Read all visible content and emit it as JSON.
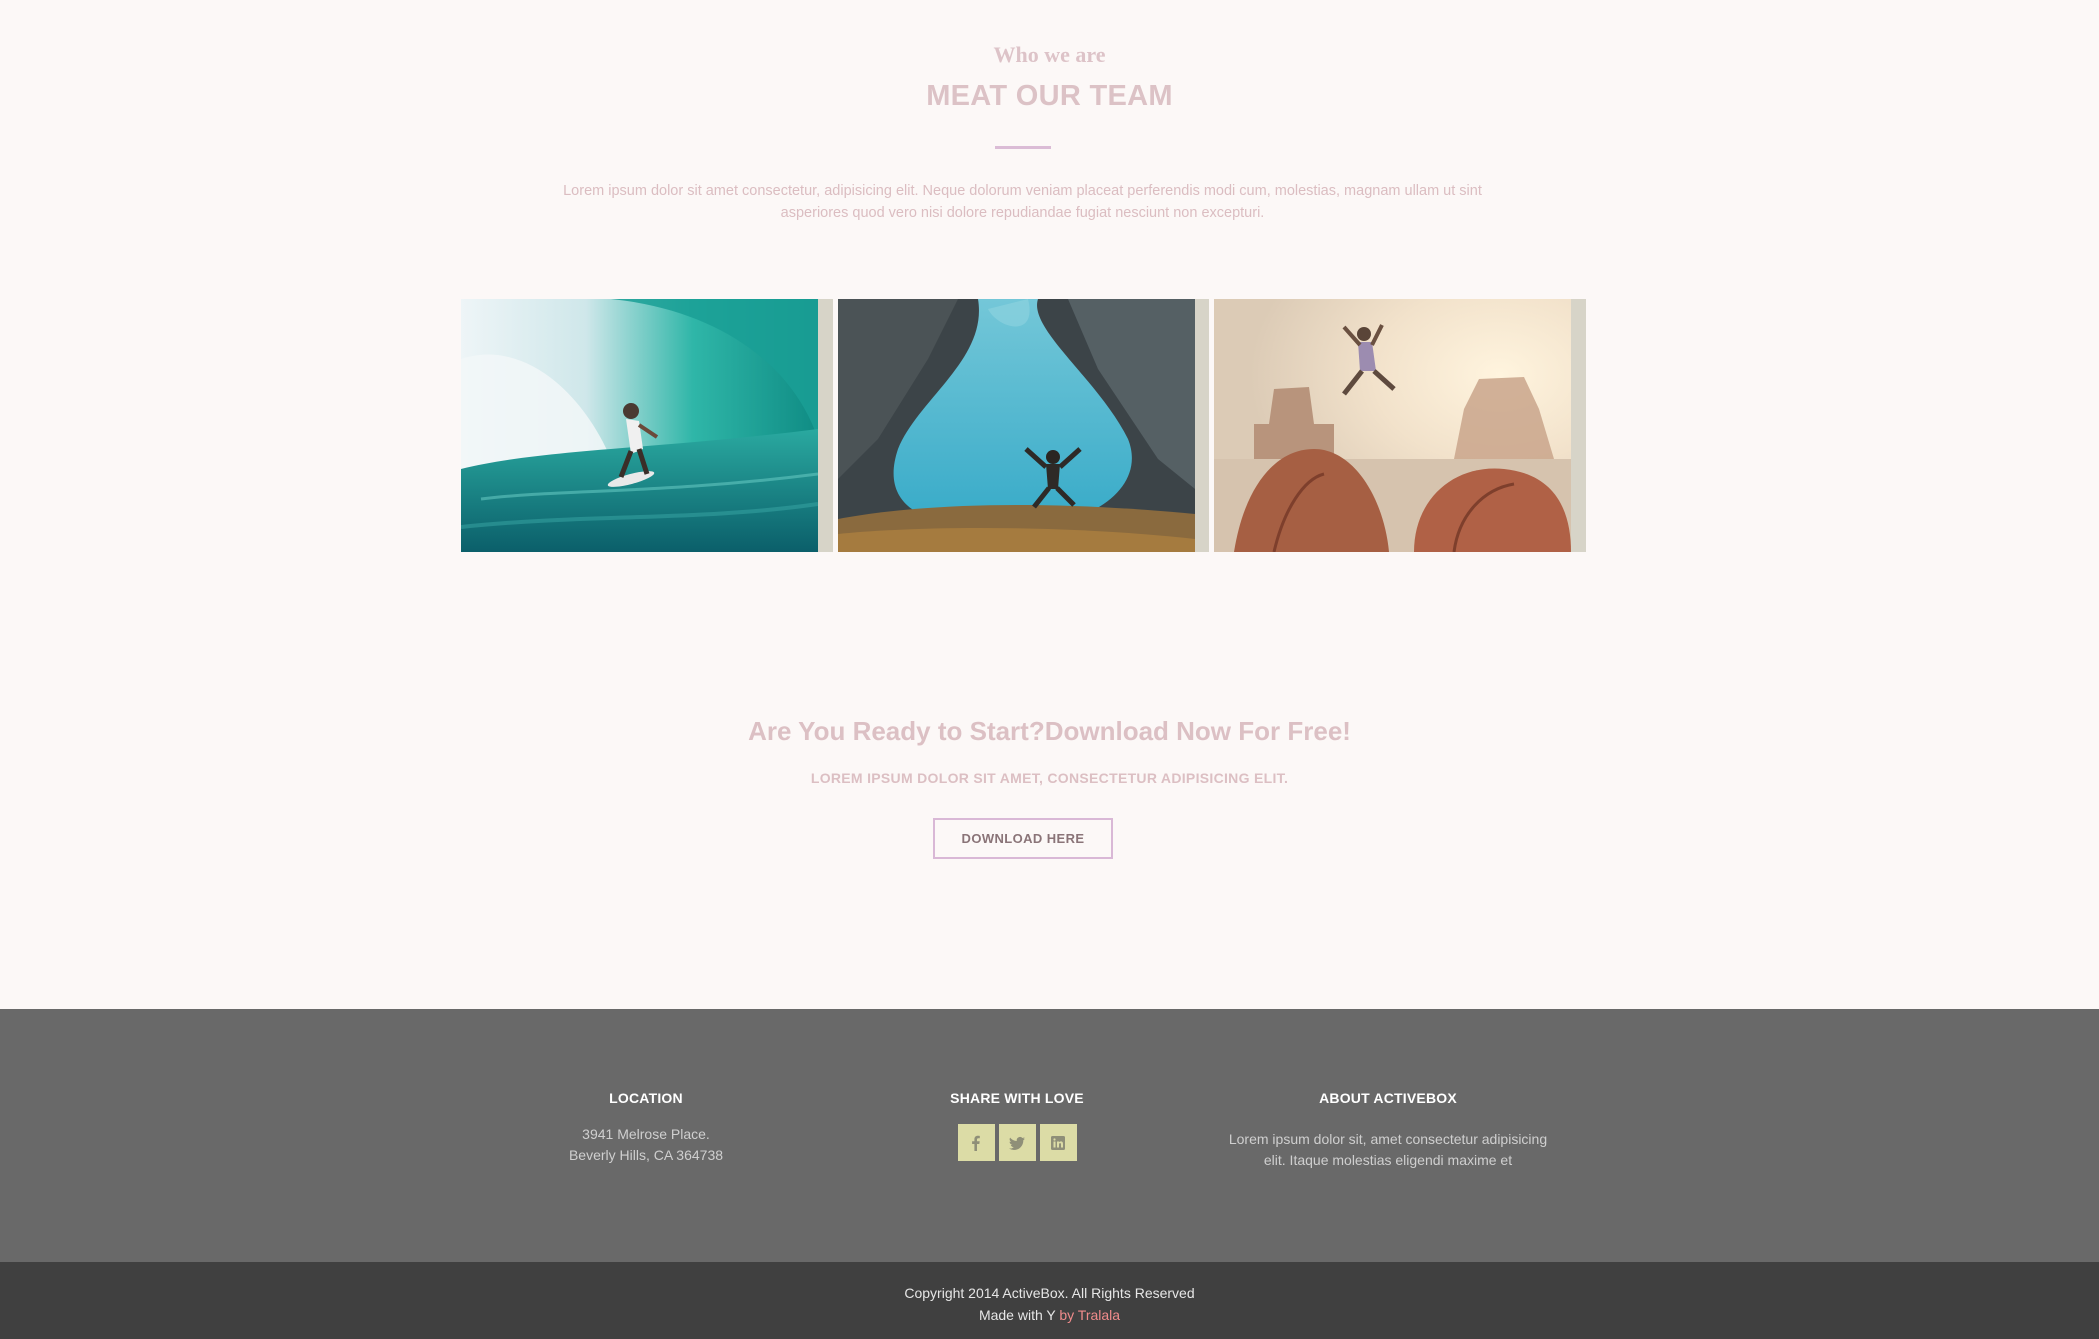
{
  "team": {
    "eyebrow": "Who we are",
    "title": "MEAT OUR TEAM",
    "intro": "Lorem ipsum dolor sit amet consectetur, adipisicing elit. Neque dolorum veniam placeat perferendis modi cum, molestias, magnam ullam ut sint asperiores quod vero nisi dolore repudiandae fugiat nesciunt non excepturi.",
    "photos": [
      {
        "subject": "surfer in a turquoise wave"
      },
      {
        "subject": "person jumping above a glacial lake"
      },
      {
        "subject": "person leaping between desert rocks"
      }
    ]
  },
  "cta": {
    "title": "Are You Ready to Start?Download Now For Free!",
    "subtitle": "LOREM IPSUM DOLOR SIT AMET, CONSECTETUR ADIPISICING ELIT.",
    "button_label": "DOWNLOAD HERE"
  },
  "footer": {
    "location": {
      "heading": "LOCATION",
      "line1": "3941 Melrose Place.",
      "line2": "Beverly Hills, CA 364738"
    },
    "share": {
      "heading": "SHARE WITH LOVE",
      "icons": [
        "facebook-icon",
        "twitter-icon",
        "linkedin-icon"
      ]
    },
    "about": {
      "heading": "ABOUT ACTIVEBOX",
      "line1": "Lorem ipsum dolor sit, amet consectetur adipisicing",
      "line2": "elit. Itaque molestias eligendi maxime et"
    },
    "copyright": "Copyright 2014 ActiveBox. All Rights Reserved",
    "made_with_prefix": "Made with Y ",
    "made_with_link": "by Tralala"
  },
  "colors": {
    "page_bg": "#fcf8f7",
    "heading_pink": "#dcc2c6",
    "divider_purple": "#dbbcd6",
    "footer_bg": "#696969",
    "footer_bottom_bg": "#404040",
    "social_bg": "#dcdca6",
    "link_color": "#f08b8b"
  }
}
